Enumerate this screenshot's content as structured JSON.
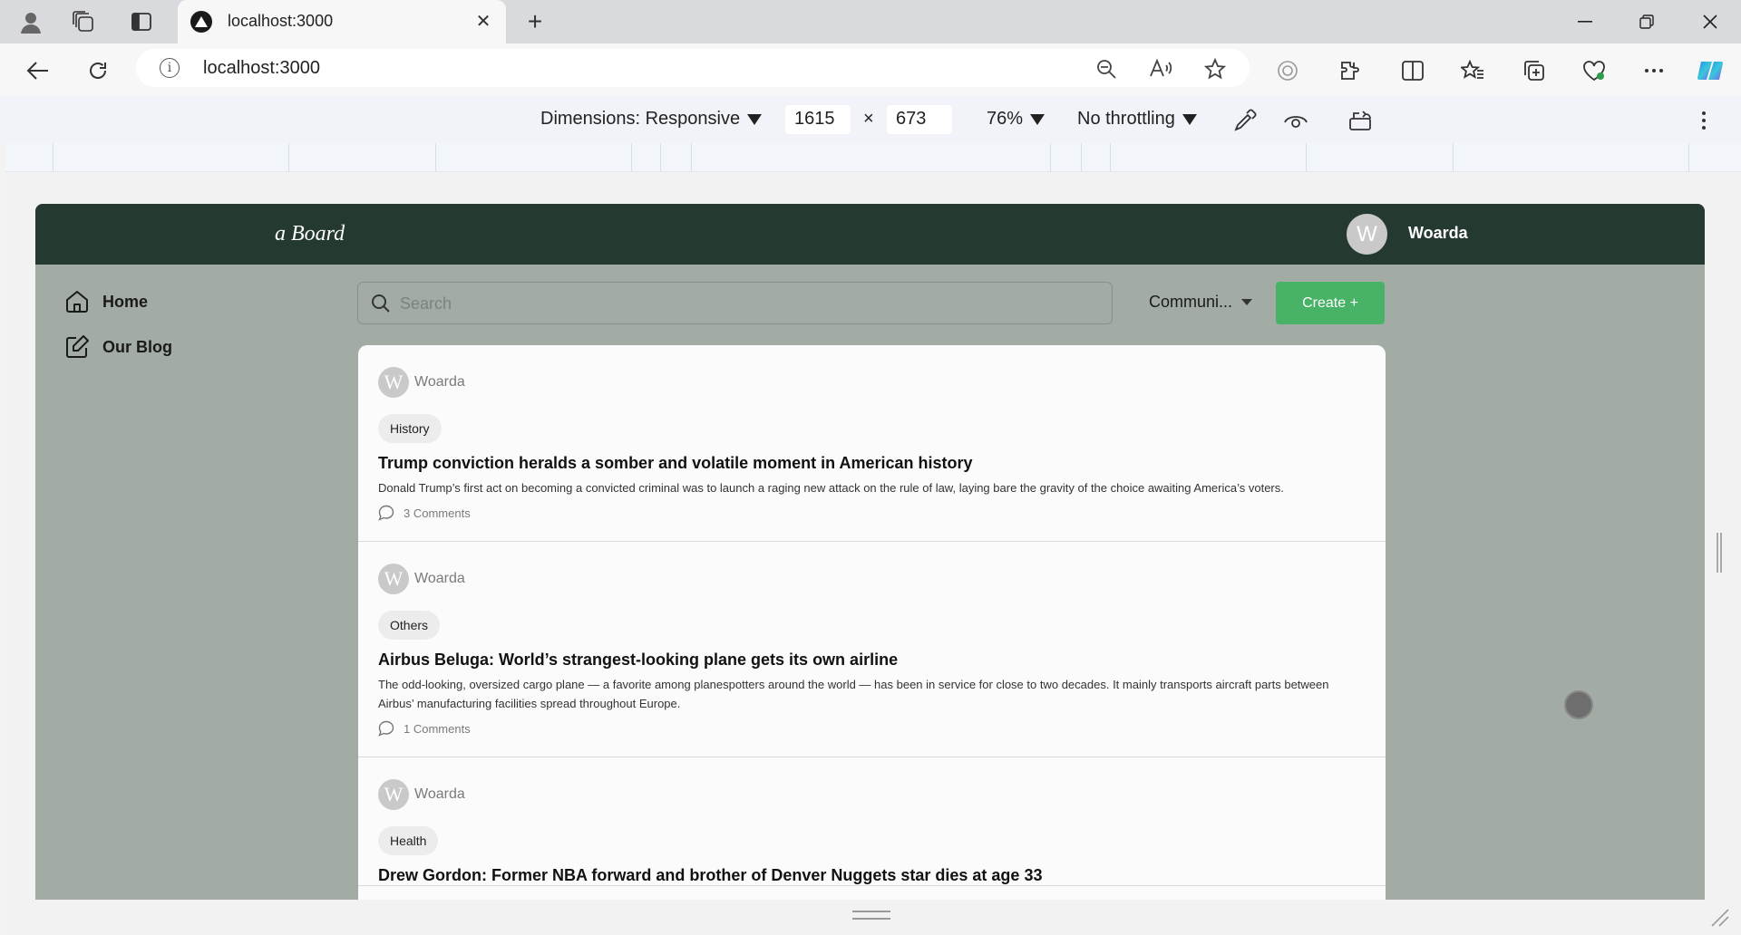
{
  "browser": {
    "tab_title": "localhost:3000",
    "url": "localhost:3000"
  },
  "devtools": {
    "dimensions_label": "Dimensions: Responsive",
    "width": "1615",
    "height": "673",
    "times": "×",
    "zoom": "76%",
    "throttling": "No throttling"
  },
  "app": {
    "brand": "a Board",
    "user": {
      "name": "Woarda",
      "initial": "W"
    },
    "sidebar": [
      {
        "label": "Home",
        "icon": "home-icon"
      },
      {
        "label": "Our Blog",
        "icon": "edit-icon"
      }
    ],
    "search": {
      "placeholder": "Search",
      "value": ""
    },
    "community_dropdown": "Communi...",
    "create_button": "Create +",
    "posts": [
      {
        "author": "Woarda",
        "initial": "W",
        "tag": "History",
        "title": "Trump conviction heralds a somber and volatile moment in American history",
        "description": "Donald Trump’s first act on becoming a convicted criminal was to launch a raging new attack on the rule of law, laying bare the gravity of the choice awaiting America’s voters.",
        "comments": "3 Comments"
      },
      {
        "author": "Woarda",
        "initial": "W",
        "tag": "Others",
        "title": "Airbus Beluga: World’s strangest-looking plane gets its own airline",
        "description": "The odd-looking, oversized cargo plane — a favorite among planespotters around the world — has been in service for close to two decades. It mainly transports aircraft parts between Airbus’ manufacturing facilities spread throughout Europe.",
        "comments": "1 Comments"
      },
      {
        "author": "Woarda",
        "initial": "W",
        "tag": "Health",
        "title": "Drew Gordon: Former NBA forward and brother of Denver Nuggets star dies at age 33",
        "description": "",
        "comments": ""
      }
    ]
  }
}
